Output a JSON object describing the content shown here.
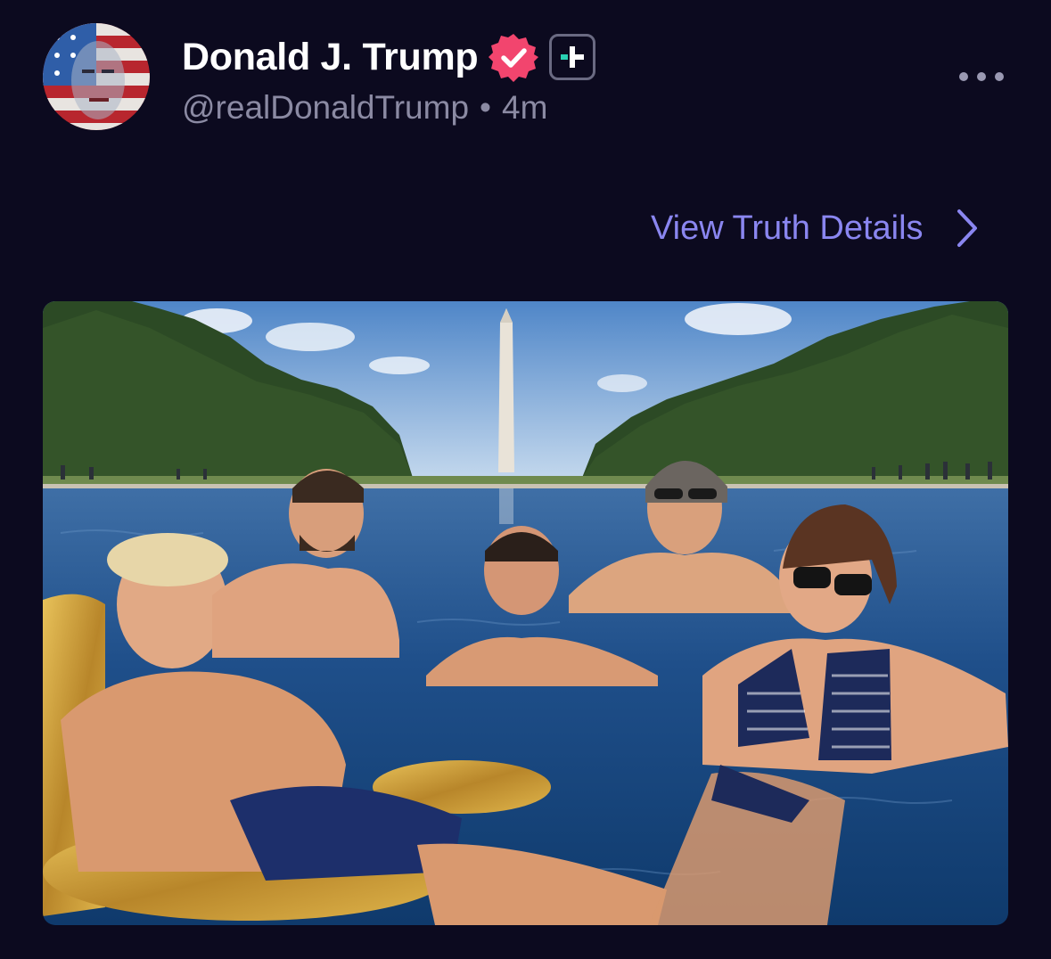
{
  "post": {
    "author": {
      "display_name": "Donald J. Trump",
      "handle": "@realDonaldTrump",
      "verified": true,
      "verified_color": "#f2456e",
      "plus_badge_color": "#29d1b3"
    },
    "separator": "•",
    "timestamp": "4m",
    "more_icon": "more-horizontal-icon",
    "details_link": {
      "label": "View Truth Details",
      "icon": "chevron-right-icon",
      "color": "#8a86f0"
    },
    "media": {
      "type": "image",
      "alt": "Photo of five people relaxing in the Lincoln Memorial Reflecting Pool with the Washington Monument in the background"
    }
  },
  "colors": {
    "background": "#0c0a1f",
    "text_primary": "#ffffff",
    "text_secondary": "#8b8aa3"
  }
}
